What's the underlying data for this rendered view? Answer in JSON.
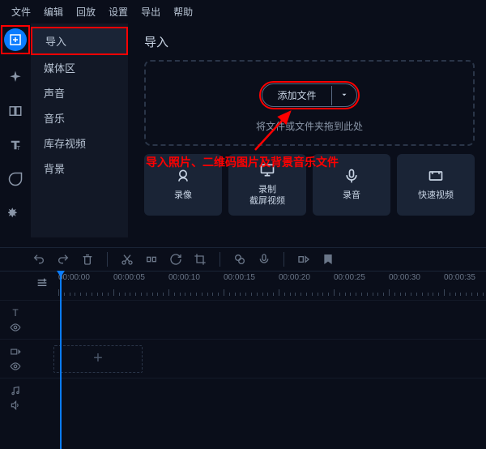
{
  "menu": {
    "file": "文件",
    "edit": "编辑",
    "playback": "回放",
    "settings": "设置",
    "export": "导出",
    "help": "帮助"
  },
  "submenu": {
    "import": "导入",
    "media": "媒体区",
    "sound": "声音",
    "music": "音乐",
    "stock_video": "库存视频",
    "background": "背景"
  },
  "content": {
    "title": "导入",
    "add_file": "添加文件",
    "drop_hint": "将文件或文件夹拖到此处"
  },
  "annotation": "导入照片、二维码图片及背景音乐文件",
  "actions": {
    "record_camera": "录像",
    "record_screen": "录制\n截屏视频",
    "record_audio": "录音",
    "quick_video": "快速视频"
  },
  "timeline": {
    "labels": [
      "00:00:00",
      "00:00:05",
      "00:00:10",
      "00:00:15",
      "00:00:20",
      "00:00:25",
      "00:00:30",
      "00:00:35"
    ]
  }
}
